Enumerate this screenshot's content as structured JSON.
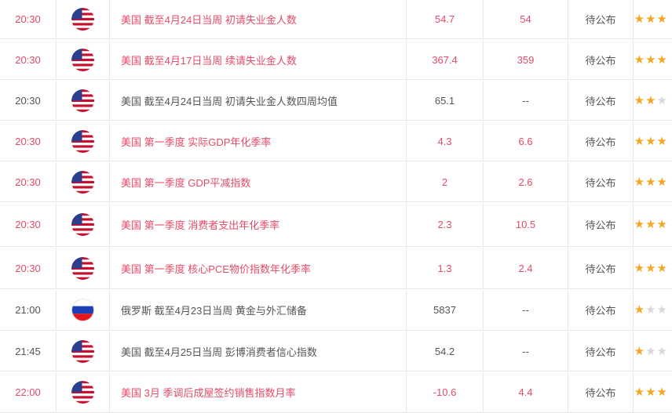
{
  "colors": {
    "important": "#e34b68",
    "normal": "#555555",
    "star_on": "#f5a623",
    "star_off": "#d8d8d8"
  },
  "rows": [
    {
      "time": "20:30",
      "country": "us",
      "event": "美国 截至4月24日当周 初请失业金人数",
      "previous": "54.7",
      "forecast": "54",
      "actual": "待公布",
      "stars": 3,
      "highlight": true
    },
    {
      "time": "20:30",
      "country": "us",
      "event": "美国 截至4月17日当周 续请失业金人数",
      "previous": "367.4",
      "forecast": "359",
      "actual": "待公布",
      "stars": 3,
      "highlight": true
    },
    {
      "time": "20:30",
      "country": "us",
      "event": "美国 截至4月24日当周 初请失业金人数四周均值",
      "previous": "65.1",
      "forecast": "--",
      "actual": "待公布",
      "stars": 2,
      "highlight": false
    },
    {
      "time": "20:30",
      "country": "us",
      "event": "美国 第一季度 实际GDP年化季率",
      "previous": "4.3",
      "forecast": "6.6",
      "actual": "待公布",
      "stars": 3,
      "highlight": true
    },
    {
      "time": "20:30",
      "country": "us",
      "event": "美国 第一季度 GDP平减指数",
      "previous": "2",
      "forecast": "2.6",
      "actual": "待公布",
      "stars": 3,
      "highlight": true
    },
    {
      "time": "20:30",
      "country": "us",
      "event": "美国 第一季度 消费者支出年化季率",
      "previous": "2.3",
      "forecast": "10.5",
      "actual": "待公布",
      "stars": 3,
      "highlight": true
    },
    {
      "time": "20:30",
      "country": "us",
      "event": "美国 第一季度 核心PCE物价指数年化季率",
      "previous": "1.3",
      "forecast": "2.4",
      "actual": "待公布",
      "stars": 3,
      "highlight": true
    },
    {
      "time": "21:00",
      "country": "ru",
      "event": "俄罗斯 截至4月23日当周 黄金与外汇储备",
      "previous": "5837",
      "forecast": "--",
      "actual": "待公布",
      "stars": 1,
      "highlight": false
    },
    {
      "time": "21:45",
      "country": "us",
      "event": "美国 截至4月25日当周 彭博消费者信心指数",
      "previous": "54.2",
      "forecast": "--",
      "actual": "待公布",
      "stars": 1,
      "highlight": false
    },
    {
      "time": "22:00",
      "country": "us",
      "event": "美国 3月 季调后成屋签约销售指数月率",
      "previous": "-10.6",
      "forecast": "4.4",
      "actual": "待公布",
      "stars": 3,
      "highlight": true
    }
  ]
}
